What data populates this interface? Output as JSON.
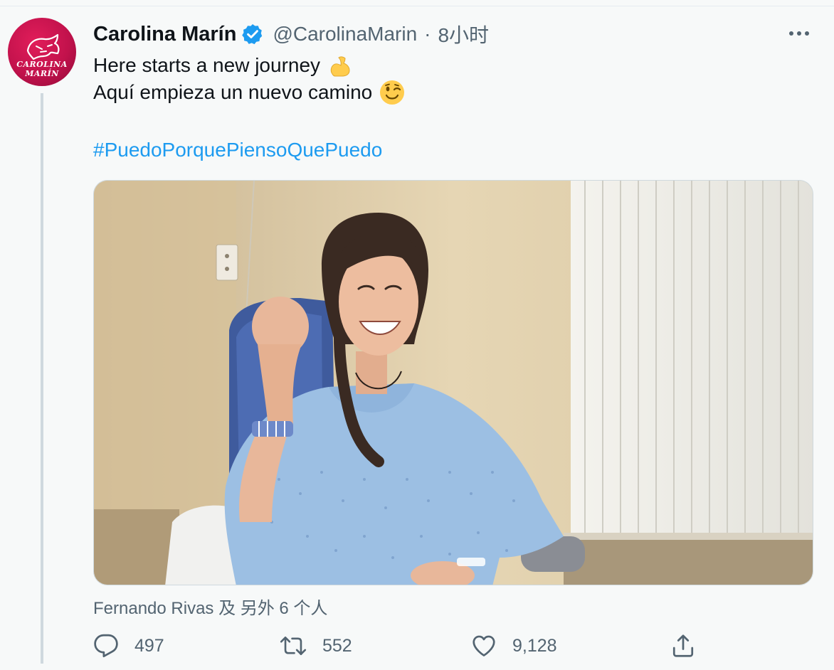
{
  "tweet": {
    "author": {
      "display_name": "Carolina Marín",
      "handle": "@CarolinaMarin",
      "verified": true,
      "avatar_text_line1": "CAROLINA",
      "avatar_text_line2": "MARÍN",
      "avatar_color": "#c2124c"
    },
    "separator": "·",
    "time": "8小时",
    "text_lines": [
      {
        "text": "Here starts a new journey",
        "emoji": "flexed-biceps-emoji"
      },
      {
        "text": "Aquí empieza un nuevo camino",
        "emoji": "winking-face-emoji"
      }
    ],
    "hashtag": "#PuedoPorquePiensoQuePuedo",
    "media": {
      "type": "photo"
    },
    "tagged": "Fernando Rivas 及 另外 6 个人",
    "actions": {
      "reply_count": "497",
      "retweet_count": "552",
      "like_count": "9,128"
    }
  },
  "colors": {
    "link": "#1d9bf0",
    "secondary_text": "#536471",
    "verified": "#1d9bf0",
    "background": "#f7f9f9"
  },
  "icons": {
    "more": "more-icon",
    "reply": "reply-icon",
    "retweet": "retweet-icon",
    "like": "heart-icon",
    "share": "share-icon"
  }
}
